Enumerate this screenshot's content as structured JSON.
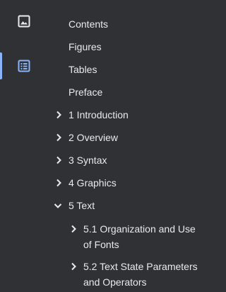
{
  "sidebar": {
    "thumbnails_icon": "image-icon",
    "outline_icon": "list-icon",
    "active": "outline"
  },
  "outline": {
    "items": [
      {
        "label": "Contents",
        "expander": "none"
      },
      {
        "label": "Figures",
        "expander": "none"
      },
      {
        "label": "Tables",
        "expander": "none"
      },
      {
        "label": "Preface",
        "expander": "none"
      },
      {
        "label": "1 Introduction",
        "expander": "collapsed"
      },
      {
        "label": "2 Overview",
        "expander": "collapsed"
      },
      {
        "label": "3 Syntax",
        "expander": "collapsed"
      },
      {
        "label": "4 Graphics",
        "expander": "collapsed"
      },
      {
        "label": "5 Text",
        "expander": "expanded"
      },
      {
        "label": "5.1 Organization and Use of Fonts",
        "expander": "collapsed"
      },
      {
        "label": "5.2 Text State Parameters and Operators",
        "expander": "collapsed"
      }
    ]
  },
  "colors": {
    "background": "#2f3134",
    "text": "#e8eaed",
    "accent": "#8ab4f8"
  }
}
